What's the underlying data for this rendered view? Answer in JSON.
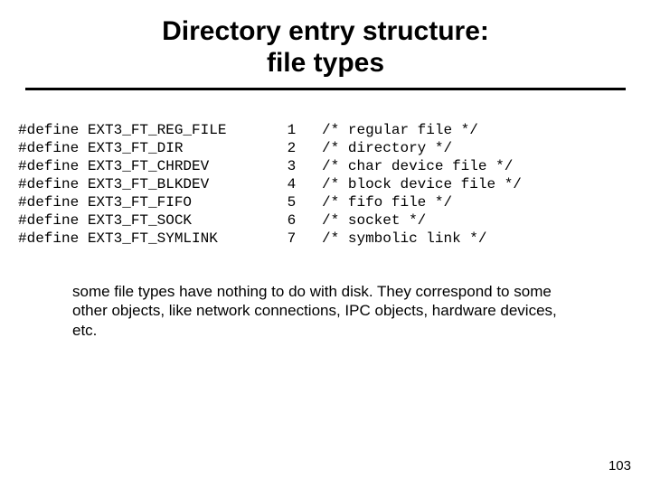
{
  "title_line1": "Directory entry structure:",
  "title_line2": "file types",
  "code": "#define EXT3_FT_REG_FILE       1   /* regular file */\n#define EXT3_FT_DIR            2   /* directory */\n#define EXT3_FT_CHRDEV         3   /* char device file */\n#define EXT3_FT_BLKDEV         4   /* block device file */\n#define EXT3_FT_FIFO           5   /* fifo file */\n#define EXT3_FT_SOCK           6   /* socket */\n#define EXT3_FT_SYMLINK        7   /* symbolic link */",
  "note": "some file types have nothing to do with disk. They correspond to some other objects, like network connections, IPC objects, hardware devices, etc.",
  "page_number": "103"
}
